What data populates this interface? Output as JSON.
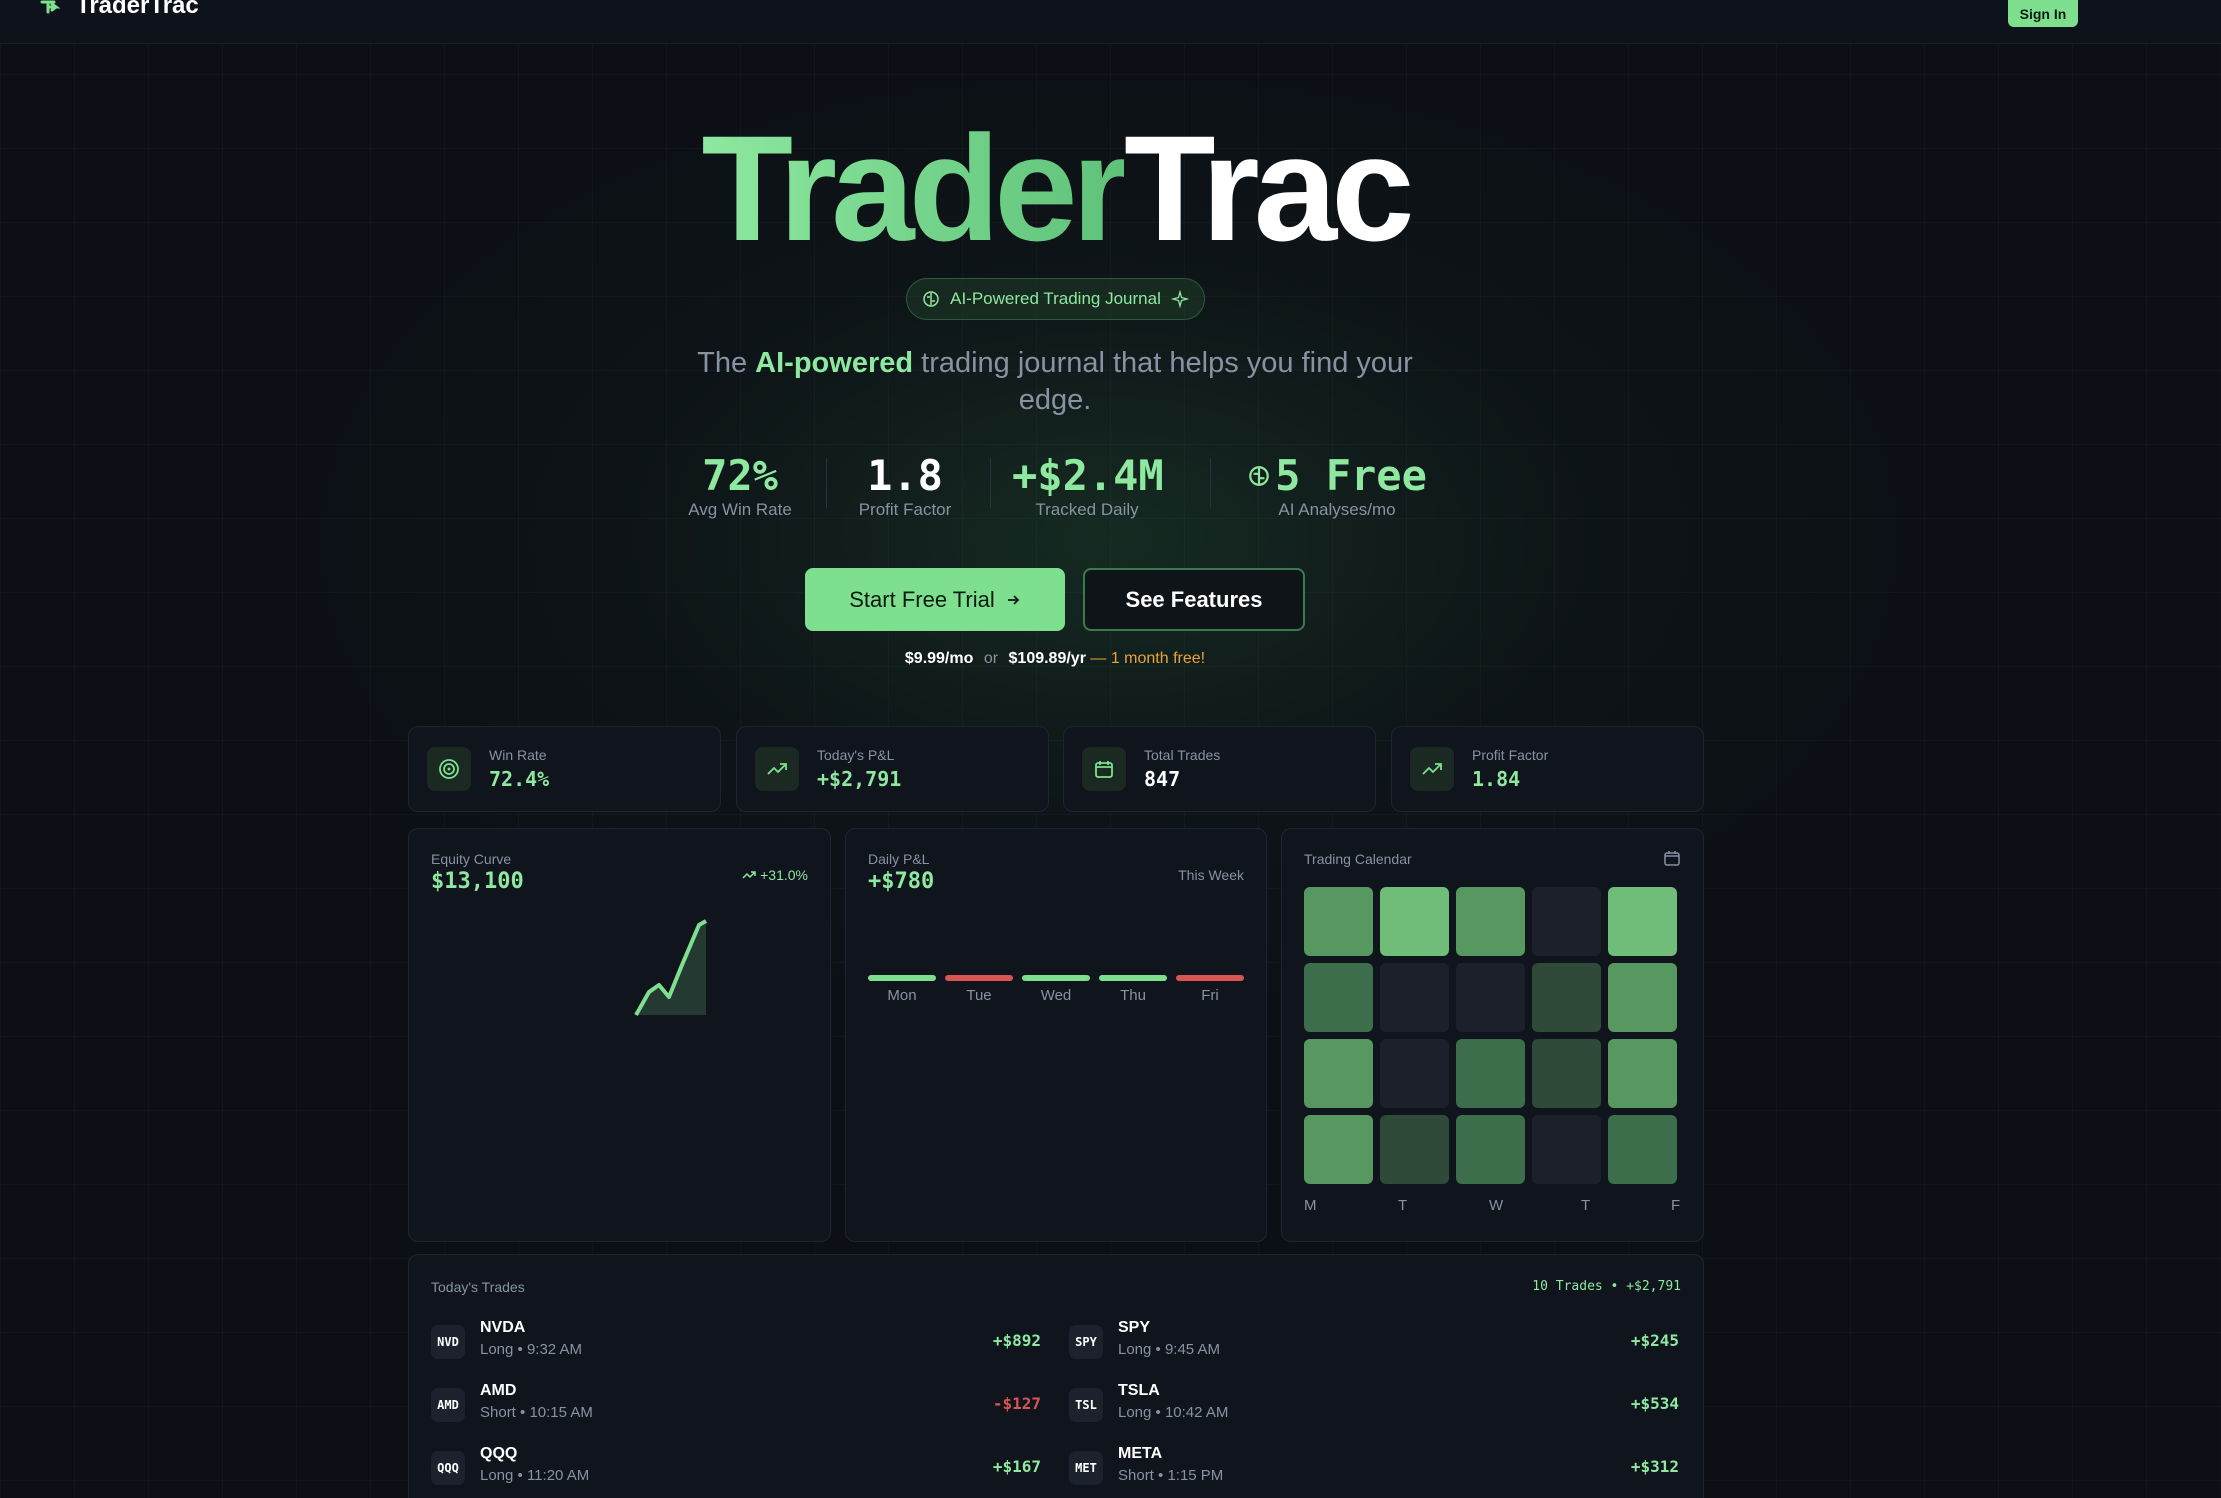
{
  "nav": {
    "brand": "TraderTrac",
    "signin_label": "Sign In"
  },
  "hero": {
    "title_green": "Trader",
    "title_white": "Trac",
    "pill": "AI-Powered Trading Journal",
    "tagline_pre": "The ",
    "tagline_highlight": "AI-powered",
    "tagline_post": " trading journal that helps you find your edge.",
    "stats": [
      {
        "value": "72%",
        "label": "Avg Win Rate"
      },
      {
        "value": "1.8",
        "label": "Profit Factor"
      },
      {
        "value": "+$2.4M",
        "label": "Tracked Daily"
      },
      {
        "value": "5 Free",
        "label": "AI Analyses/mo"
      }
    ],
    "cta_primary": "Start Free Trial",
    "cta_secondary": "See Features",
    "price_month": "$9.99/mo",
    "price_or": "or",
    "price_year": "$109.89/yr",
    "price_promo": "— 1 month free!"
  },
  "metrics": [
    {
      "label": "Win Rate",
      "value": "72.4%",
      "icon": "target-icon"
    },
    {
      "label": "Today's P&L",
      "value": "+$2,791",
      "icon": "trending-up-icon"
    },
    {
      "label": "Total Trades",
      "value": "847",
      "icon": "calendar-icon"
    },
    {
      "label": "Profit Factor",
      "value": "1.84",
      "icon": "trending-up-icon"
    }
  ],
  "equity": {
    "label": "Equity Curve",
    "value": "$13,100",
    "change": "+31.0%"
  },
  "daily": {
    "label": "Daily P&L",
    "value": "+$780",
    "period": "This Week",
    "days": [
      {
        "day": "Mon",
        "positive": true
      },
      {
        "day": "Tue",
        "positive": false
      },
      {
        "day": "Wed",
        "positive": true
      },
      {
        "day": "Thu",
        "positive": true
      },
      {
        "day": "Fri",
        "positive": false
      }
    ]
  },
  "calendar": {
    "label": "Trading Calendar",
    "day_labels": [
      "M",
      "T",
      "W",
      "T",
      "F"
    ],
    "intensity_levels": [
      [
        3,
        4,
        3,
        0,
        4
      ],
      [
        2,
        0,
        0,
        1,
        3
      ],
      [
        3,
        0,
        2,
        1,
        3
      ],
      [
        3,
        1,
        2,
        0,
        2
      ]
    ],
    "colors": [
      "#1c202b",
      "#2f4a39",
      "#3d6e4b",
      "#56985f",
      "#6fbd78"
    ]
  },
  "trades": {
    "label": "Today's Trades",
    "summary": "10 Trades • +$2,791",
    "items": [
      {
        "ticker": "NVD",
        "name": "NVDA",
        "detail": "Long • 9:32 AM",
        "pnl": "+$892",
        "negative": false
      },
      {
        "ticker": "SPY",
        "name": "SPY",
        "detail": "Long • 9:45 AM",
        "pnl": "+$245",
        "negative": false
      },
      {
        "ticker": "AMD",
        "name": "AMD",
        "detail": "Short • 10:15 AM",
        "pnl": "-$127",
        "negative": true
      },
      {
        "ticker": "TSL",
        "name": "TSLA",
        "detail": "Long • 10:42 AM",
        "pnl": "+$534",
        "negative": false
      },
      {
        "ticker": "QQQ",
        "name": "QQQ",
        "detail": "Long • 11:20 AM",
        "pnl": "+$167",
        "negative": false
      },
      {
        "ticker": "MET",
        "name": "META",
        "detail": "Short • 1:15 PM",
        "pnl": "+$312",
        "negative": false
      }
    ]
  },
  "colors": {
    "accent": "#7ee08f",
    "negative": "#d95454",
    "background": "#0c1016",
    "promo": "#e8a33a"
  }
}
